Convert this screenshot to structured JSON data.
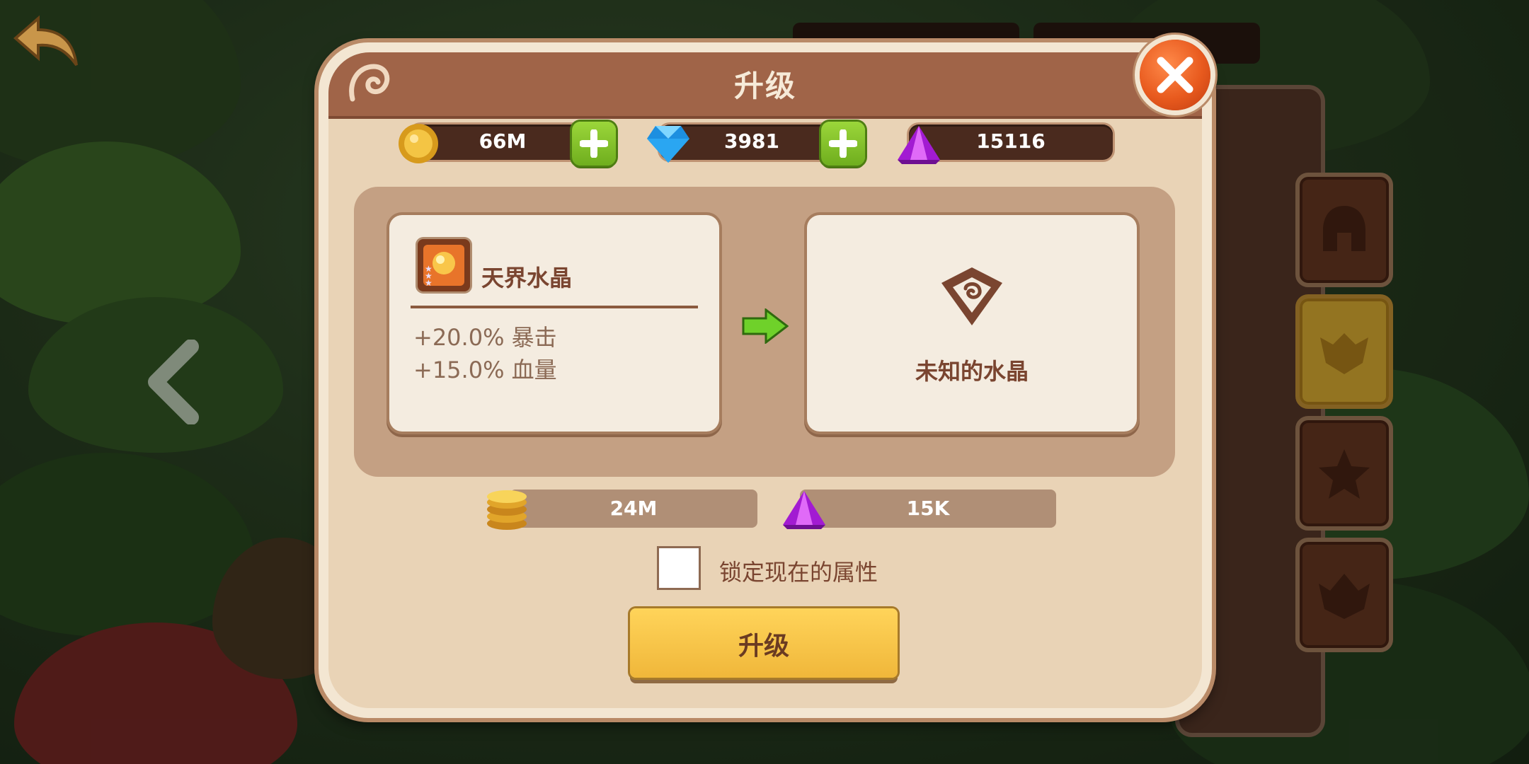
{
  "modal": {
    "title": "升级"
  },
  "currencies": [
    {
      "icon": "gold-coin-icon",
      "value": "66M",
      "has_plus": true
    },
    {
      "icon": "blue-diamond-icon",
      "value": "3981",
      "has_plus": true
    },
    {
      "icon": "purple-crystal-icon",
      "value": "15116",
      "has_plus": false
    }
  ],
  "current_item": {
    "name": "天界水晶",
    "stars": 3,
    "attributes": [
      "+20.0% 暴击",
      "+15.0% 血量"
    ]
  },
  "result_item": {
    "name": "未知的水晶"
  },
  "cost": {
    "gold": "24M",
    "crystal": "15K"
  },
  "lock": {
    "label": "锁定现在的属性",
    "checked": false
  },
  "upgrade_button": {
    "label": "升级"
  },
  "colors": {
    "header": "#a06448",
    "panel": "#e9d3b6",
    "button": "#f7c84a",
    "close": "#e85a1e",
    "plus": "#86c52c"
  }
}
